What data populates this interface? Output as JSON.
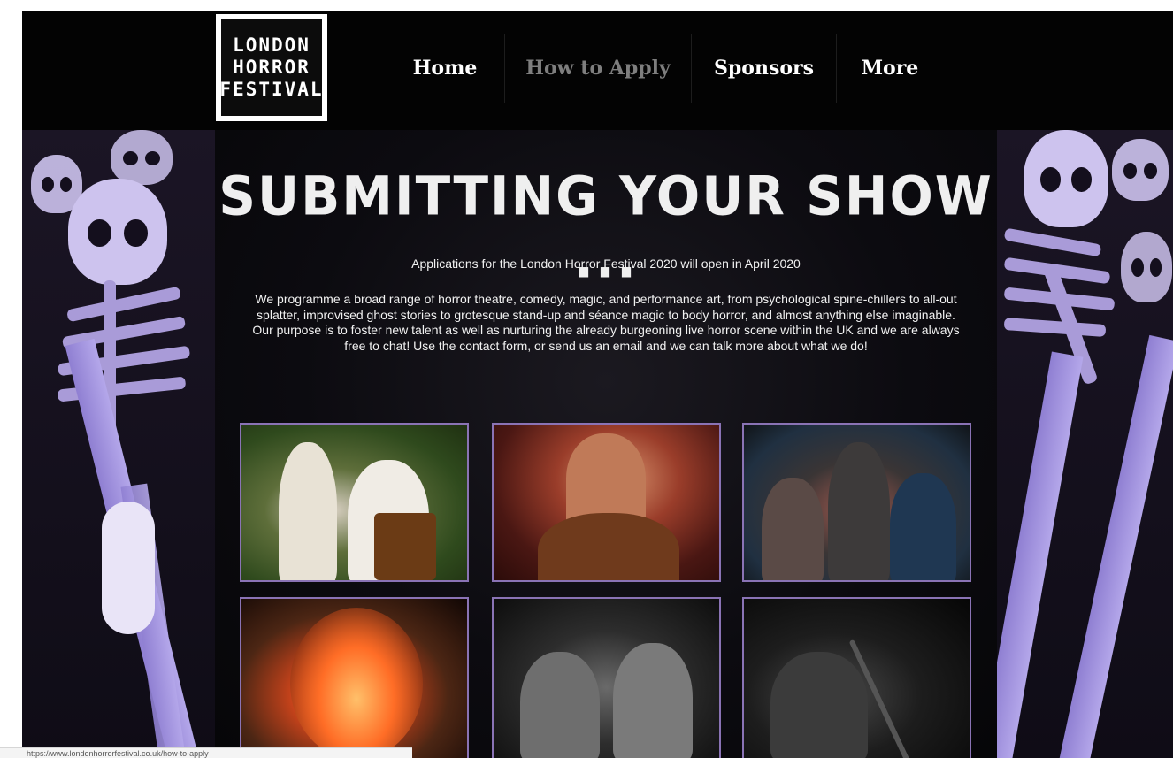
{
  "logo": {
    "lines": [
      "LONDON",
      "HORROR",
      "FESTIVAL"
    ]
  },
  "nav": {
    "items": [
      {
        "label": "Home",
        "active": false
      },
      {
        "label": "How to Apply",
        "active": true
      },
      {
        "label": "Sponsors",
        "active": false
      },
      {
        "label": "More",
        "active": false
      }
    ]
  },
  "main": {
    "title": "SUBMITTING YOUR SHOW ...",
    "subtitle": "Applications for the London Horror Festival 2020 will open in April 2020",
    "paragraph": "We programme a broad range of horror theatre, comedy, magic, and performance art, from psychological spine-chillers to all-out splatter, improvised ghost stories to grotesque stand-up and séance magic to body horror, and almost anything else imaginable. Our purpose is to foster new talent as well as nurturing the already burgeoning live horror scene within the UK and we are always free to chat! Use the contact form, or send us an email and we can talk more about what we do!",
    "gallery": [
      {
        "name": "gallery-photo-ouija-couple"
      },
      {
        "name": "gallery-photo-bearded-man"
      },
      {
        "name": "gallery-photo-hooded-group"
      },
      {
        "name": "gallery-photo-burning-ouija"
      },
      {
        "name": "gallery-photo-two-women"
      },
      {
        "name": "gallery-photo-microphone-performer"
      }
    ]
  },
  "statusbar": {
    "url": "https://www.londonhorrorfestival.co.uk/how-to-apply"
  },
  "colors": {
    "accent_purple": "#8a73b5",
    "nav_active": "#7e7e7e",
    "background": "#000000"
  }
}
